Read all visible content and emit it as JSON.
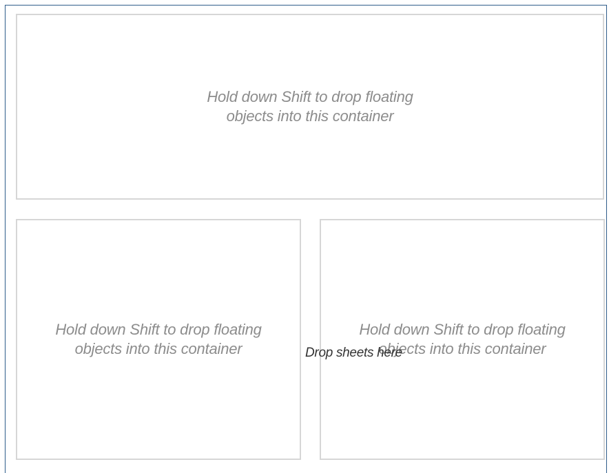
{
  "dashboard": {
    "containers": [
      {
        "hint": "Hold down Shift to drop floating\nobjects into this container"
      },
      {
        "hint": "Hold down Shift to drop floating\nobjects into this container"
      },
      {
        "hint": "Hold down Shift to drop floating\nobjects into this container"
      }
    ],
    "drop_target_label": "Drop sheets here"
  }
}
